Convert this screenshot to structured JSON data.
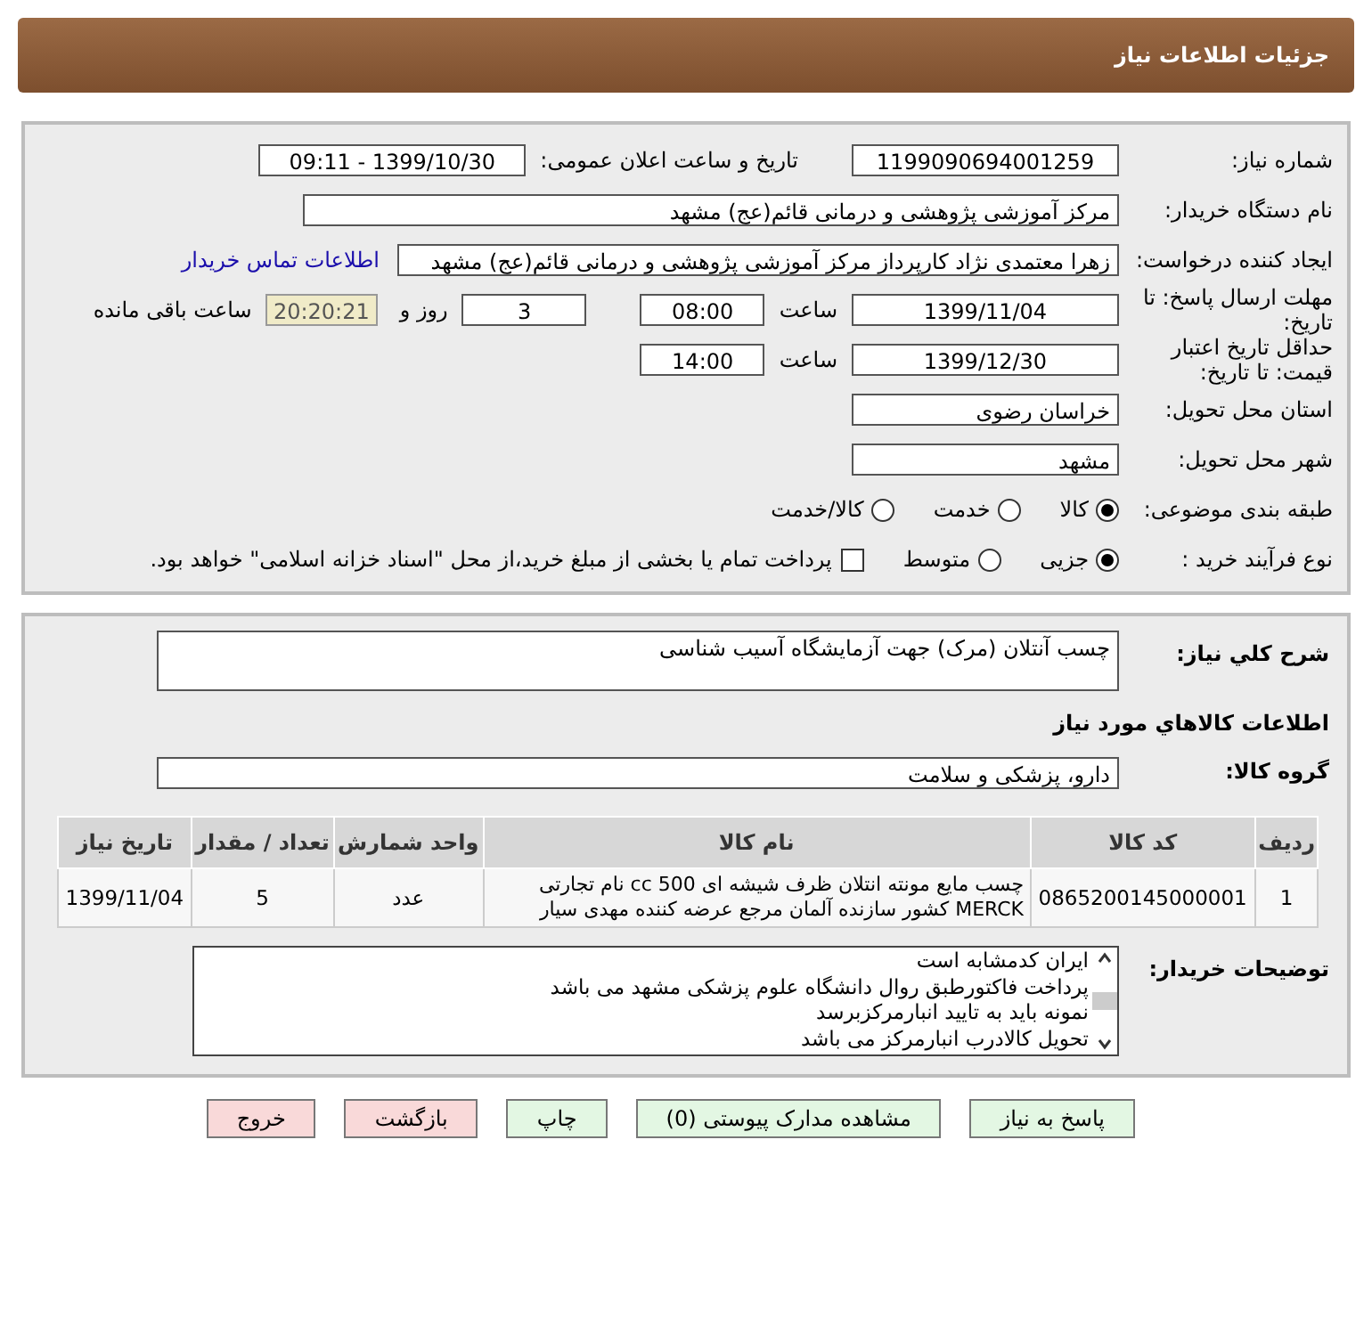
{
  "header": {
    "title": "جزئیات اطلاعات نیاز"
  },
  "need_number": {
    "label": "شماره نیاز:",
    "value": "1199090694001259"
  },
  "announce": {
    "label": "تاریخ و ساعت اعلان عمومی:",
    "value": "1399/10/30 - 09:11"
  },
  "buyer": {
    "label": "نام دستگاه خریدار:",
    "value": "مرکز آموزشی پژوهشی و درمانی قائم(عج) مشهد"
  },
  "requester": {
    "label": "ایجاد کننده درخواست:",
    "value": "زهرا معتمدی نژاد کارپرداز مرکز آموزشی پژوهشی و درمانی قائم(عج) مشهد",
    "link": "اطلاعات تماس خریدار"
  },
  "deadline": {
    "label": "مهلت ارسال پاسخ: تا تاریخ:",
    "date": "1399/11/04",
    "time_label": "ساعت",
    "time": "08:00",
    "days": "3",
    "days_label": "روز و",
    "remaining": "20:20:21",
    "remaining_label": "ساعت باقی مانده"
  },
  "validity": {
    "label": "حداقل تاریخ اعتبار قیمت: تا تاریخ:",
    "date": "1399/12/30",
    "time_label": "ساعت",
    "time": "14:00"
  },
  "province": {
    "label": "استان محل تحویل:",
    "value": "خراسان رضوی"
  },
  "city": {
    "label": "شهر محل تحویل:",
    "value": "مشهد"
  },
  "category": {
    "label": "طبقه بندی موضوعی:",
    "options": [
      {
        "label": "کالا",
        "selected": true
      },
      {
        "label": "خدمت",
        "selected": false
      },
      {
        "label": "کالا/خدمت",
        "selected": false
      }
    ]
  },
  "process": {
    "label": "نوع فرآیند خرید :",
    "options": [
      {
        "label": "جزیی",
        "selected": true
      },
      {
        "label": "متوسط",
        "selected": false
      }
    ],
    "payment": {
      "checked": false,
      "text": "پرداخت تمام یا بخشی از مبلغ خرید،از محل \"اسناد خزانه اسلامی\" خواهد بود."
    }
  },
  "description": {
    "label": "شرح کلي نياز:",
    "value": "چسب آنتلان (مرک) جهت آزمایشگاه آسیب شناسی"
  },
  "goods_title": "اطلاعات کالاهاي مورد نياز",
  "group": {
    "label": "گروه کالا:",
    "value": "دارو، پزشکی و سلامت"
  },
  "table": {
    "columns": [
      "ردیف",
      "کد کالا",
      "نام کالا",
      "واحد شمارش",
      "تعداد / مقدار",
      "تاریخ نیاز"
    ],
    "rows": [
      {
        "cells": [
          "1",
          "0865200145000001",
          "چسب مایع مونته انتلان ظرف شیشه ای 500 cc نام تجارتی MERCK کشور سازنده آلمان مرجع عرضه کننده مهدی سیار",
          "عدد",
          "5",
          "1399/11/04"
        ]
      }
    ]
  },
  "notes": {
    "label": "توضیحات خریدار:",
    "lines": [
      "ایران کدمشابه است",
      "پرداخت فاکتورطبق روال دانشگاه علوم پزشکی مشهد می باشد",
      "نمونه باید به تایید انبارمرکزبرسد",
      "تحویل کالادرب انبارمرکز می باشد"
    ]
  },
  "buttons": [
    {
      "label": "پاسخ به نیاز",
      "kind": "normal"
    },
    {
      "label": "مشاهده مدارک پیوستی (0)",
      "kind": "normal"
    },
    {
      "label": "چاپ",
      "kind": "normal"
    },
    {
      "label": "بازگشت",
      "kind": "danger"
    },
    {
      "label": "خروج",
      "kind": "danger"
    }
  ]
}
